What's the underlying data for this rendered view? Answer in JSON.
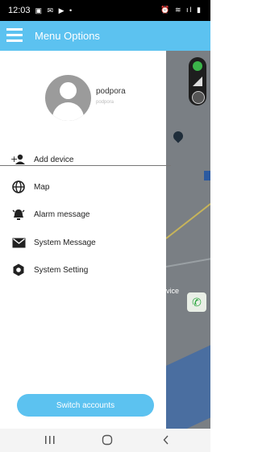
{
  "status_bar": {
    "time": "12:03",
    "left_icons": "▣ ✉ ▶ •",
    "right_icons": "⏰ ≋ ıl ▮"
  },
  "app_bar": {
    "title": "Menu Options",
    "color": "#5cc2f0"
  },
  "profile": {
    "name": "podpora",
    "subtitle": "podpora"
  },
  "menu": [
    {
      "label": "Add device",
      "icon": "add-person-icon"
    },
    {
      "label": "Map",
      "icon": "globe-icon"
    },
    {
      "label": "Alarm message",
      "icon": "alarm-bell-icon"
    },
    {
      "label": "System Message",
      "icon": "envelope-icon"
    },
    {
      "label": "System Setting",
      "icon": "gear-icon"
    }
  ],
  "switch_button": {
    "label": "Switch accounts"
  },
  "map": {
    "partial_text": "vice"
  }
}
